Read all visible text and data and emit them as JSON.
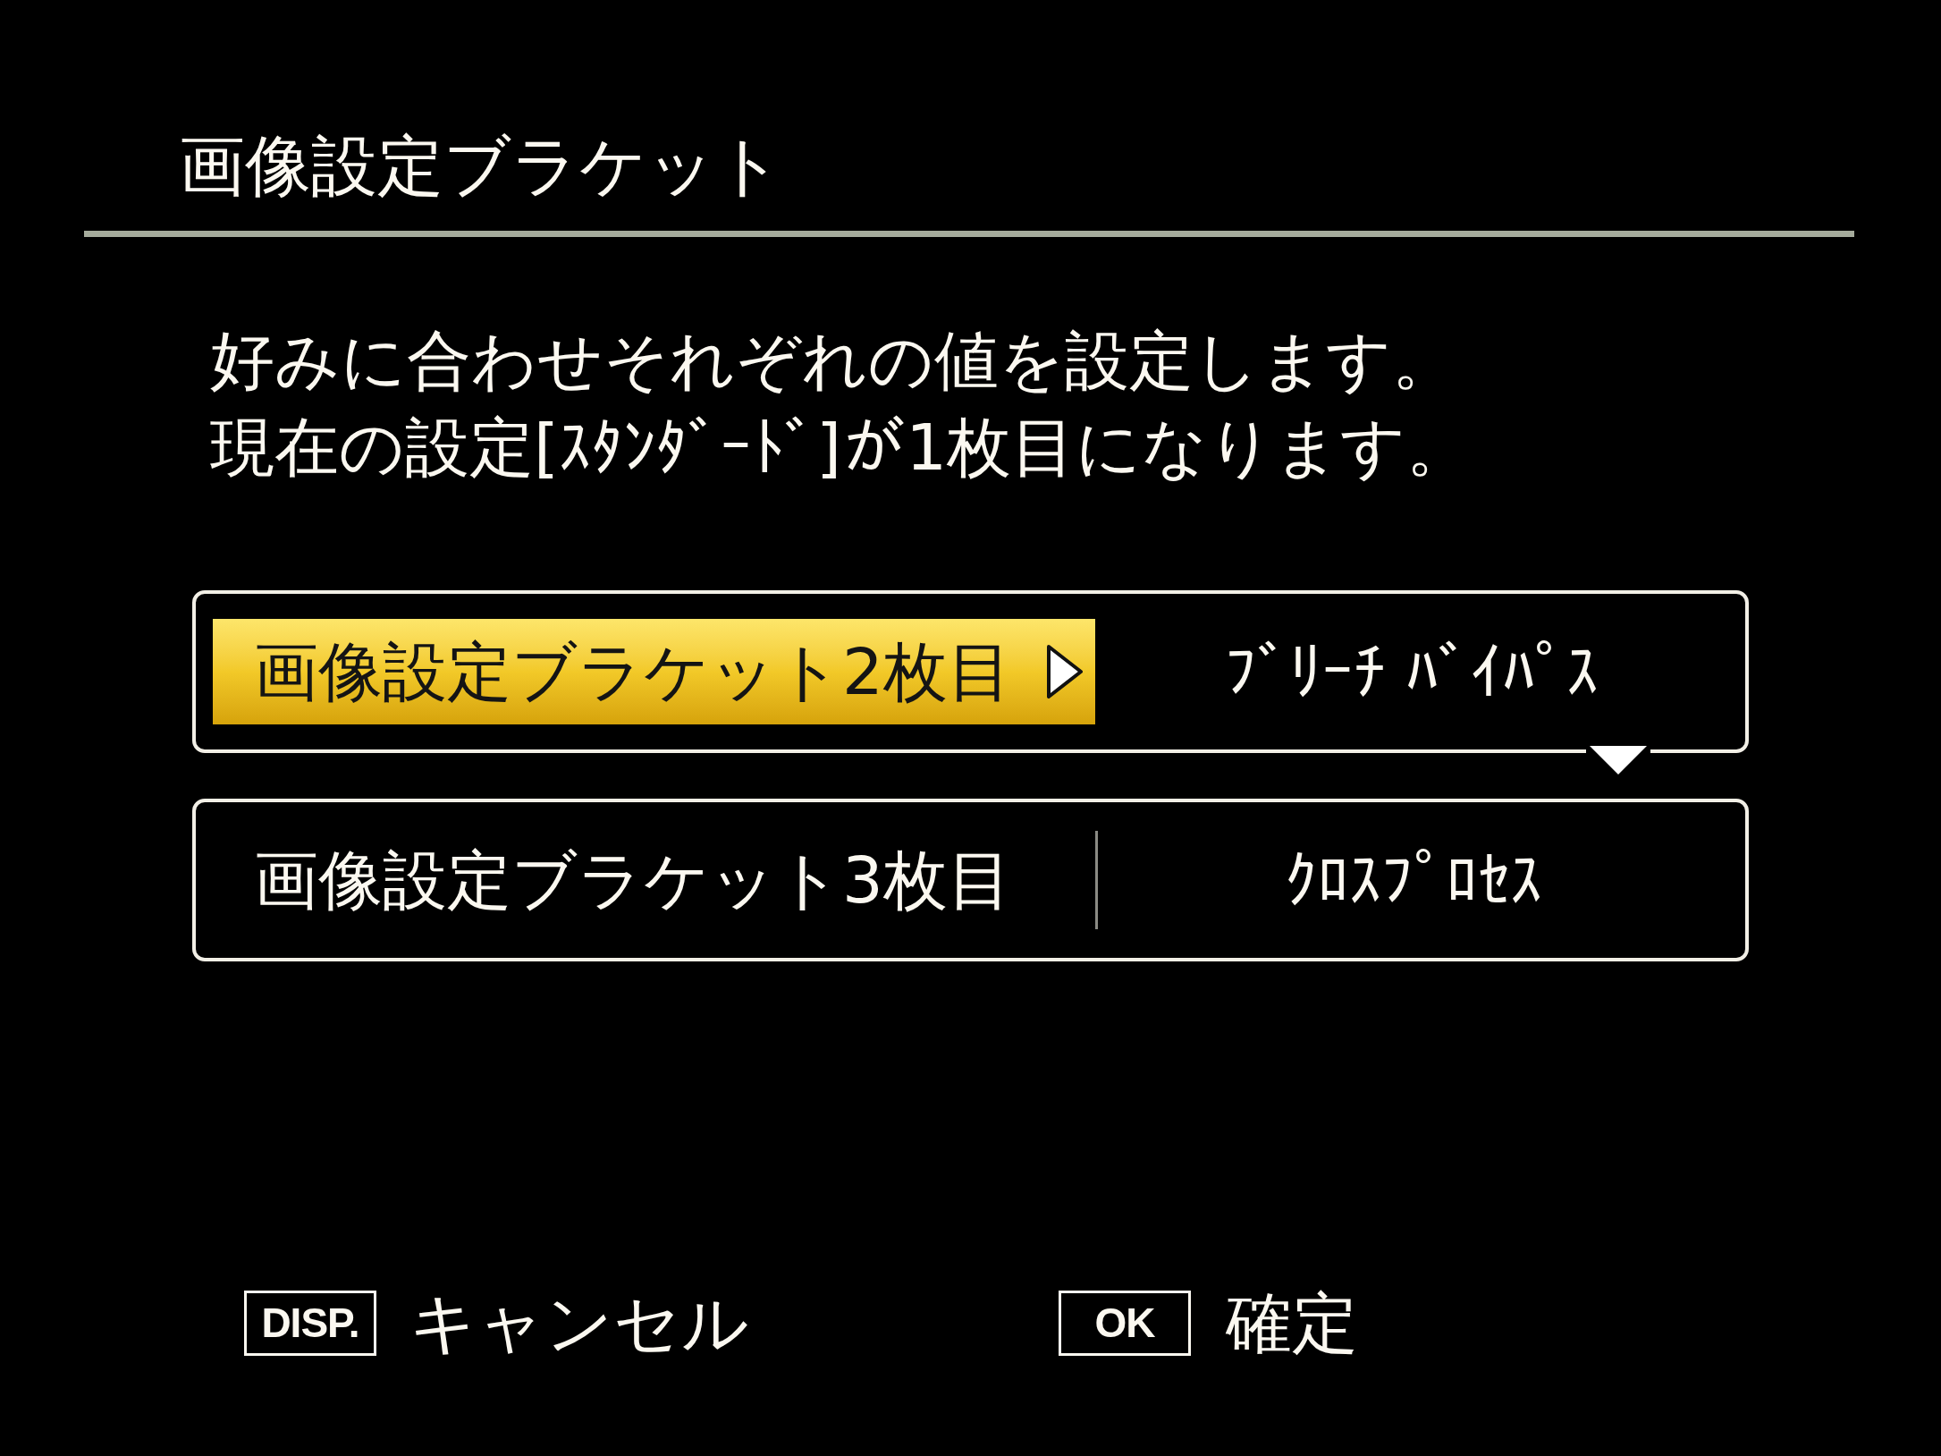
{
  "screen": {
    "title": "画像設定ブラケット"
  },
  "description": [
    "好みに合わせそれぞれの値を設定します。",
    "現在の設定[ｽﾀﾝﾀﾞｰﾄﾞ]が1枚目になります。"
  ],
  "settings": [
    {
      "label": "画像設定ブラケット2枚目",
      "value": "ﾌﾞﾘｰﾁ ﾊﾞｲﾊﾟｽ",
      "selected": true
    },
    {
      "label": "画像設定ブラケット3枚目",
      "value": "ｸﾛｽﾌﾟﾛｾｽ",
      "selected": false
    }
  ],
  "footer": [
    {
      "key": "DISP.",
      "label": "キャンセル"
    },
    {
      "key": "OK",
      "label": "確定"
    }
  ]
}
